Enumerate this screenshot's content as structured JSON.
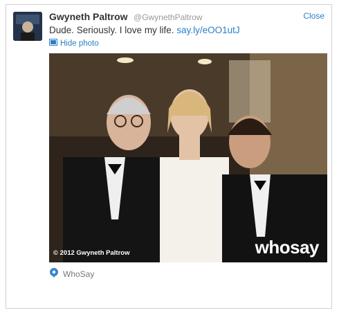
{
  "tweet": {
    "user_name": "Gwyneth Paltrow",
    "user_handle": "@GwynethPaltrow",
    "close_label": "Close",
    "text": "Dude. Seriously. I love my life.",
    "link": "say.ly/eOO1utJ",
    "hide_photo_label": "Hide photo",
    "photo_copyright": "© 2012 Gwyneth Paltrow",
    "photo_brand": "whosay",
    "source_label": "WhoSay"
  },
  "colors": {
    "link": "#2a7ec7",
    "muted": "#999999"
  },
  "icons": {
    "photo": "image-icon",
    "source": "whosay-icon"
  }
}
